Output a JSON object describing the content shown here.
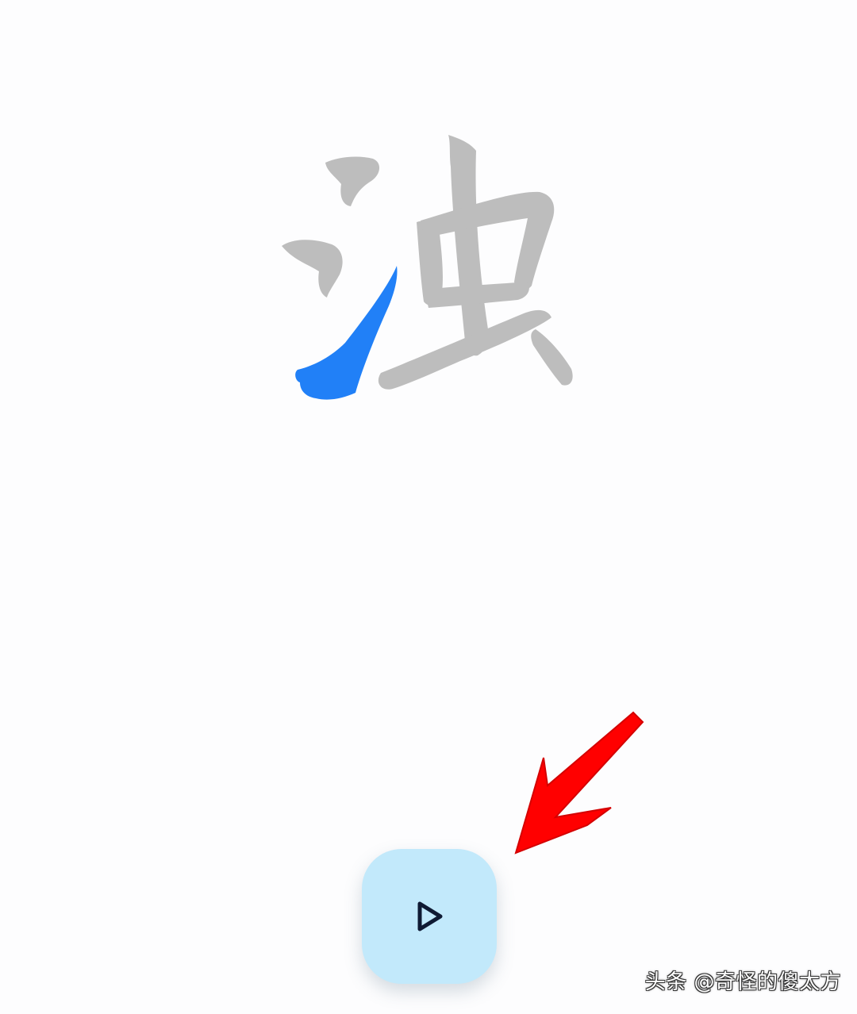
{
  "character": {
    "glyph": "浊",
    "base_color": "#bdbdbd",
    "highlight_color": "#2180f7"
  },
  "controls": {
    "play_icon": "play-triangle-icon",
    "button_color": "#c2e9fb",
    "icon_color": "#0f1a33"
  },
  "annotation": {
    "arrow_icon": "red-arrow-icon",
    "arrow_color": "#ff0000"
  },
  "watermark": {
    "text": "头条 @奇怪的傻太方"
  }
}
